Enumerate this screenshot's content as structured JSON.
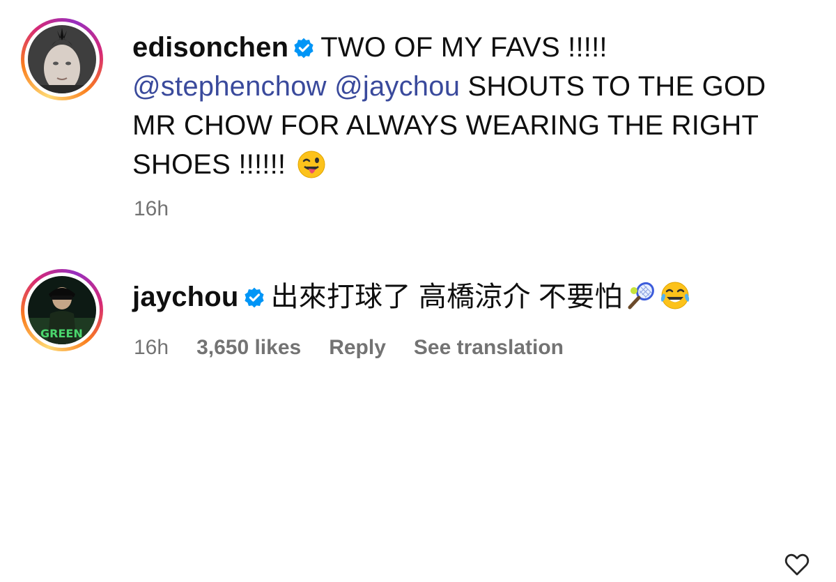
{
  "comments": [
    {
      "username": "edisonchen",
      "verified": true,
      "text_line1": "TWO OF MY FAVS !!!!!",
      "mentions": [
        "@stephenchow",
        "@jaychou"
      ],
      "text_rest_1": "SHOUTS TO THE GOD",
      "text_rest_2": "MR CHOW FOR ALWAYS WEARING THE RIGHT",
      "text_rest_3": "SHOES !!!!!!",
      "emoji": "winking-face-with-tongue",
      "time": "16h"
    },
    {
      "username": "jaychou",
      "verified": true,
      "text": "出來打球了 高橋涼介 不要怕",
      "emojis": [
        "tennis-racket",
        "face-with-tears-of-joy"
      ],
      "time": "16h",
      "likes": "3,650 likes",
      "reply": "Reply",
      "see_translation": "See translation"
    }
  ],
  "colors": {
    "text": "#0f0f0f",
    "mention": "#3a4a9c",
    "meta": "#737373",
    "verified": "#0095f6"
  },
  "icons": [
    "verified-badge-icon",
    "heart-icon"
  ]
}
